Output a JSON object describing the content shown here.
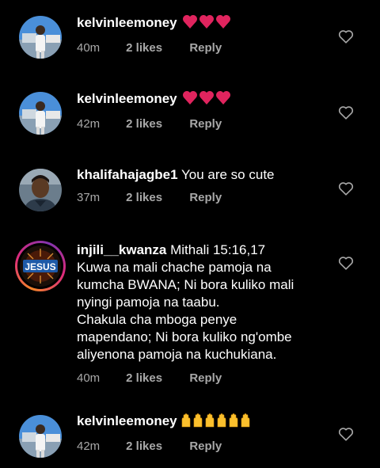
{
  "comments": [
    {
      "username": "kelvinleemoney",
      "text": "",
      "emoji": "heart-red",
      "emoji_count": 3,
      "time": "40m",
      "likes": "2 likes",
      "reply_label": "Reply",
      "avatar": "kelvin"
    },
    {
      "username": "kelvinleemoney",
      "text": "",
      "emoji": "heart-red",
      "emoji_count": 3,
      "time": "42m",
      "likes": "2 likes",
      "reply_label": "Reply",
      "avatar": "kelvin"
    },
    {
      "username": "khalifahajagbe1",
      "text": " You are so cute",
      "time": "37m",
      "likes": "2 likes",
      "reply_label": "Reply",
      "avatar": "khalifa"
    },
    {
      "username": "injili__kwanza",
      "text": " Mithali 15:16,17",
      "lines": [
        " Kuwa na mali chache pamoja na",
        "kumcha BWANA; Ni bora kuliko mali",
        "nyingi pamoja na taabu.",
        " Chakula cha mboga penye",
        "mapendano; Ni bora kuliko ng'ombe",
        "aliyenona pamoja na kuchukiana."
      ],
      "time": "40m",
      "likes": "2 likes",
      "reply_label": "Reply",
      "avatar": "jesus",
      "avatar_text": "JESUS"
    },
    {
      "username": "kelvinleemoney",
      "text": "",
      "emoji": "raised-hands",
      "emoji_count": 6,
      "time": "42m",
      "likes": "2 likes",
      "reply_label": "Reply",
      "avatar": "kelvin"
    }
  ],
  "colors": {
    "background": "#000000",
    "text": "#ffffff",
    "secondary": "#a8a8a8",
    "heart_emoji": "#e0245e",
    "hands_emoji": "#fbc02d"
  },
  "icons": {
    "like": "heart-outline-icon",
    "heart_emoji": "red-heart-emoji-icon",
    "hands_emoji": "raised-hands-emoji-icon"
  }
}
